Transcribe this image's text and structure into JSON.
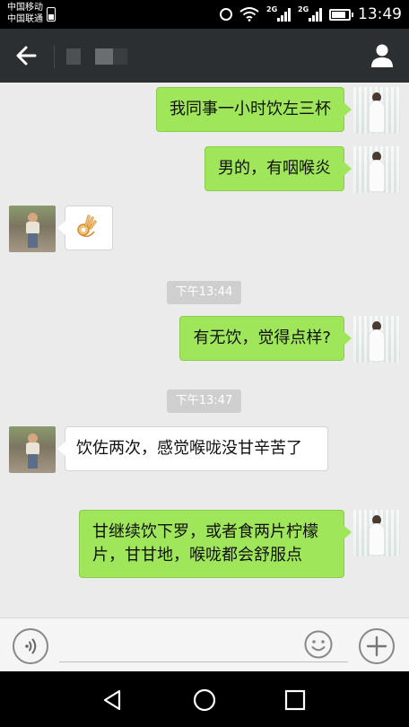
{
  "status_bar": {
    "carrier_1": "中国移动",
    "carrier_2": "中国联通",
    "network_1": "2G",
    "network_2": "2G",
    "time": "13:49",
    "icons": [
      "sim-icon",
      "alarm-icon",
      "wifi-icon",
      "signal-icon",
      "signal-icon",
      "battery-icon"
    ]
  },
  "nav_bar": {
    "back_icon": "arrow-left-icon",
    "contact_icon": "person-icon"
  },
  "messages": [
    {
      "side": "self",
      "text": "我同事一小时饮左三杯"
    },
    {
      "side": "self",
      "text": "男的，有咽喉炎"
    },
    {
      "side": "other",
      "emoji": "ok-hand-emoji"
    },
    {
      "type": "time",
      "text": "下午13:44"
    },
    {
      "side": "self",
      "text": "有无饮，觉得点样?"
    },
    {
      "type": "time",
      "text": "下午13:47"
    },
    {
      "side": "other",
      "text": "饮佐两次，感觉喉咙没甘辛苦了"
    },
    {
      "side": "self",
      "text": "甘继续饮下罗，或者食两片柠檬片，甘甘地，喉咙都会舒服点"
    }
  ],
  "input_bar": {
    "voice_icon": "voice-icon",
    "emoji_icon": "smiley-icon",
    "plus_icon": "plus-icon",
    "input_value": ""
  },
  "system_nav": {
    "icons": [
      "back-triangle-icon",
      "home-circle-icon",
      "recents-square-icon"
    ]
  },
  "colors": {
    "self_bubble": "#9fe65a",
    "other_bubble": "#ffffff",
    "nav_bar": "#2b2f31",
    "chat_background": "#ebebeb"
  }
}
